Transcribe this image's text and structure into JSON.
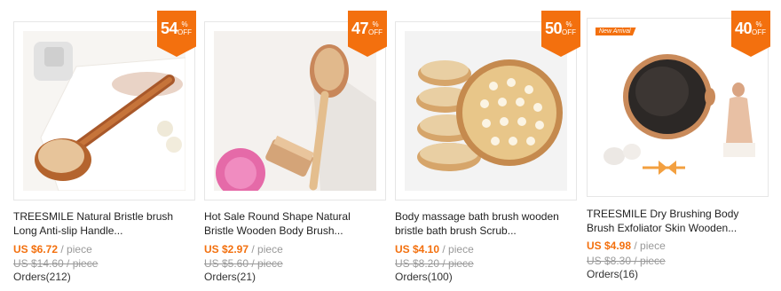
{
  "products": [
    {
      "badge_num": "54",
      "badge_pct": "%",
      "badge_off": "OFF",
      "title_line1": "TREESMILE Natural Bristle brush",
      "title_line2": "Long Anti-slip Handle...",
      "price": "US $6.72",
      "unit": " / piece",
      "old_price": "US $14.60 / piece",
      "orders": "Orders(212)"
    },
    {
      "badge_num": "47",
      "badge_pct": "%",
      "badge_off": "OFF",
      "title_line1": "Hot Sale Round Shape Natural",
      "title_line2": "Bristle Wooden Body Brush...",
      "price": "US $2.97",
      "unit": " / piece",
      "old_price": "US $5.60 / piece",
      "orders": "Orders(21)"
    },
    {
      "badge_num": "50",
      "badge_pct": "%",
      "badge_off": "OFF",
      "title_line1": "Body massage bath brush wooden",
      "title_line2": "bristle bath brush Scrub...",
      "price": "US $4.10",
      "unit": " / piece",
      "old_price": "US $8.20 / piece",
      "orders": "Orders(100)"
    },
    {
      "badge_num": "40",
      "badge_pct": "%",
      "badge_off": "OFF",
      "new_label": "New Arrival",
      "title_line1": "TREESMILE Dry Brushing Body",
      "title_line2": "Brush Exfoliator Skin Wooden...",
      "price": "US $4.98",
      "unit": " / piece",
      "old_price": "US $8.30 / piece",
      "orders": "Orders(16)"
    }
  ],
  "colors": {
    "accent": "#f3700e",
    "muted": "#999999",
    "border": "#e6e6e6"
  }
}
